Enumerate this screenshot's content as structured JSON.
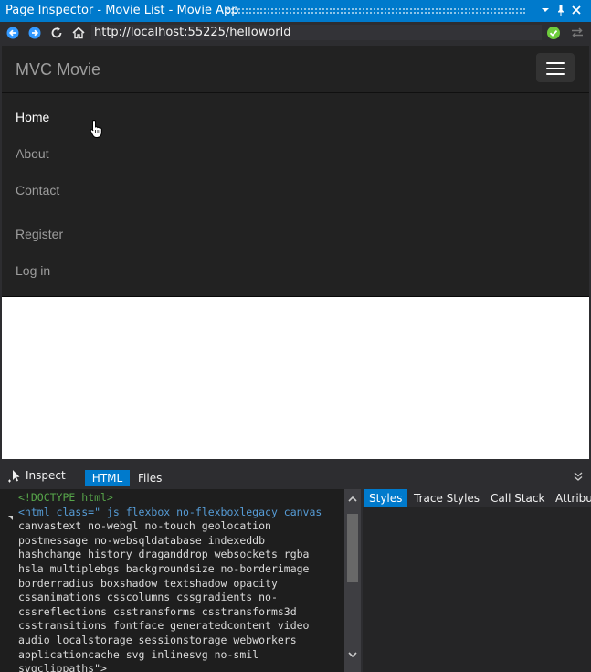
{
  "window": {
    "title": "Page Inspector - Movie List - Movie App",
    "controls": [
      "dropdown",
      "pin",
      "close"
    ]
  },
  "address": {
    "url": "http://localhost:55225/helloworld"
  },
  "page": {
    "brand": "MVC Movie",
    "nav": [
      "Home",
      "About",
      "Contact",
      "Register",
      "Log in"
    ],
    "active_nav": "Home"
  },
  "devtools": {
    "inspect_label": "Inspect",
    "tabs": [
      "HTML",
      "Files"
    ],
    "active_tab": "HTML",
    "code_lines": [
      "<!DOCTYPE html>",
      "<html class=\" js flexbox no-flexboxlegacy canvas",
      "canvastext no-webgl no-touch geolocation",
      "postmessage no-websqldatabase indexeddb",
      "hashchange history draganddrop websockets rgba",
      "hsla multiplebgs backgroundsize no-borderimage",
      "borderradius boxshadow textshadow opacity",
      "cssanimations csscolumns cssgradients no-",
      "cssreflections csstransforms csstransforms3d",
      "csstransitions fontface generatedcontent video",
      "audio localstorage sessionstorage webworkers",
      "applicationcache svg inlinesvg no-smil",
      "svgclippaths\">"
    ],
    "style_tabs": [
      "Styles",
      "Trace Styles",
      "Call Stack",
      "Attribu"
    ],
    "active_style_tab": "Styles"
  },
  "colors": {
    "accent": "#007acc",
    "navbar": "#222222",
    "status_ok": "#6ecc3c"
  }
}
